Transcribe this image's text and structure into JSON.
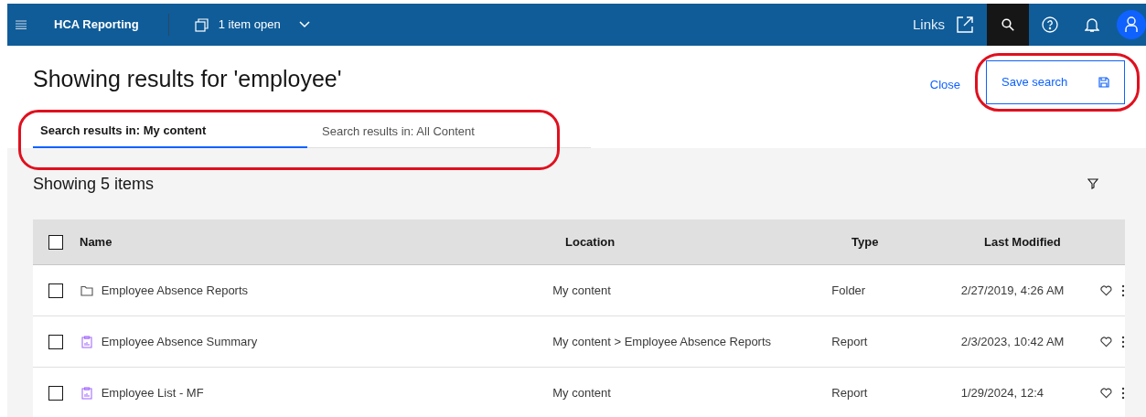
{
  "header": {
    "app_name": "HCA Reporting",
    "open_items": "1 item open",
    "links": "Links"
  },
  "page": {
    "title": "Showing results for 'employee'",
    "close": "Close",
    "save_search": "Save search"
  },
  "tabs": [
    {
      "label": "Search results in: My content",
      "selected": true
    },
    {
      "label": "Search results in: All Content",
      "selected": false
    }
  ],
  "results": {
    "count": "Showing 5 items",
    "select_all_checked": false,
    "columns": [
      "Name",
      "Location",
      "Type",
      "Last Modified"
    ],
    "rows": [
      {
        "kind": "folder",
        "name": "Employee Absence Reports",
        "location": "My content",
        "type": "Folder",
        "modified": "2/27/2019, 4:26 AM",
        "checked": false
      },
      {
        "kind": "report",
        "name": "Employee Absence Summary",
        "location": "My content > Employee Absence Reports",
        "type": "Report",
        "modified": "2/3/2023, 10:42 AM",
        "checked": false
      },
      {
        "kind": "report",
        "name": "Employee List - MF",
        "location": "My content",
        "type": "Report",
        "modified": "1/29/2024, 12:4",
        "checked": false
      }
    ]
  }
}
